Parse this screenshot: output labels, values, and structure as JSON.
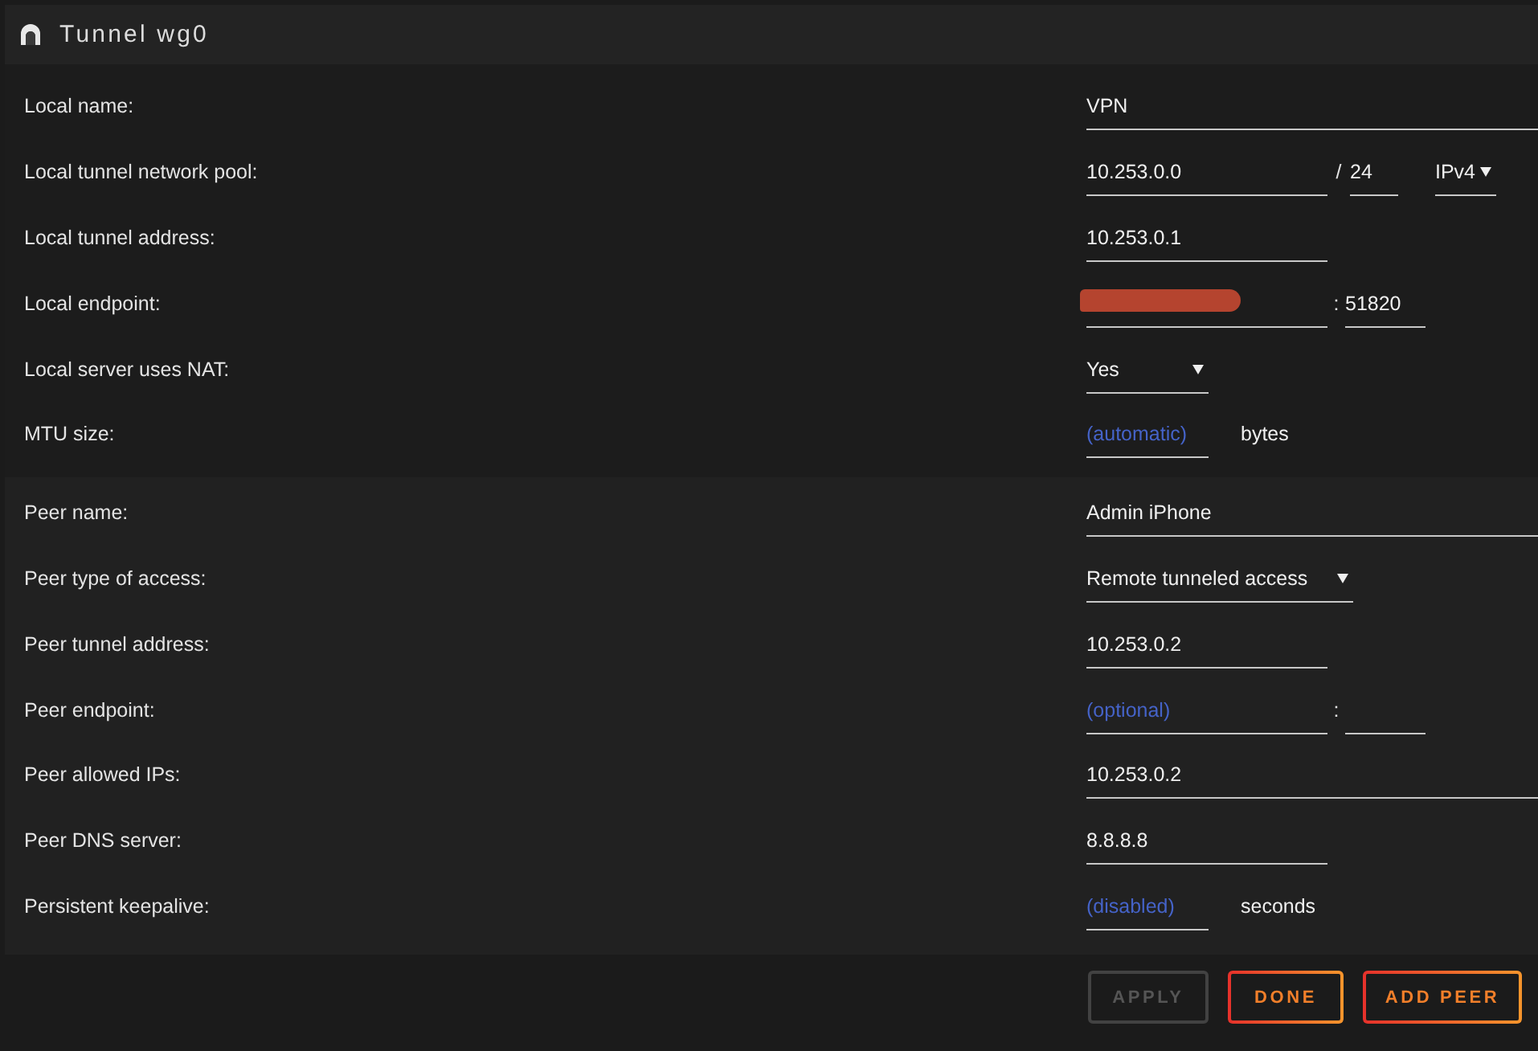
{
  "header": {
    "title": "Tunnel wg0"
  },
  "sections": [
    {
      "rows": [
        {
          "label": "Local name:",
          "controls": [
            {
              "kind": "input",
              "value": "VPN"
            }
          ]
        },
        {
          "label": "Local tunnel network pool:",
          "controls": [
            {
              "kind": "input",
              "value": "10.253.0.0"
            },
            {
              "kind": "text",
              "text": "/"
            },
            {
              "kind": "input",
              "value": "24"
            },
            {
              "kind": "select",
              "value": "IPv4"
            }
          ]
        },
        {
          "label": "Local tunnel address:",
          "controls": [
            {
              "kind": "input",
              "value": "10.253.0.1"
            }
          ]
        },
        {
          "label": "Local endpoint:",
          "controls": [
            {
              "kind": "input",
              "redacted": true
            },
            {
              "kind": "text",
              "text": ":"
            },
            {
              "kind": "input",
              "value": "51820"
            }
          ]
        },
        {
          "label": "Local server uses NAT:",
          "controls": [
            {
              "kind": "select",
              "value": "Yes"
            }
          ]
        },
        {
          "label": "MTU size:",
          "controls": [
            {
              "kind": "input",
              "placeholder": "(automatic)"
            },
            {
              "kind": "text",
              "text": "bytes"
            }
          ]
        }
      ]
    },
    {
      "rows": [
        {
          "label": "Peer name:",
          "controls": [
            {
              "kind": "input",
              "value": "Admin iPhone"
            }
          ]
        },
        {
          "label": "Peer type of access:",
          "controls": [
            {
              "kind": "select",
              "value": "Remote tunneled access"
            }
          ]
        },
        {
          "label": "Peer tunnel address:",
          "controls": [
            {
              "kind": "input",
              "value": "10.253.0.2"
            }
          ]
        },
        {
          "label": "Peer endpoint:",
          "controls": [
            {
              "kind": "input",
              "placeholder": "(optional)"
            },
            {
              "kind": "text",
              "text": ":"
            },
            {
              "kind": "input"
            }
          ]
        },
        {
          "label": "Peer allowed IPs:",
          "controls": [
            {
              "kind": "input",
              "value": "10.253.0.2"
            }
          ]
        },
        {
          "label": "Peer DNS server:",
          "controls": [
            {
              "kind": "input",
              "value": "8.8.8.8"
            }
          ]
        },
        {
          "label": "Persistent keepalive:",
          "controls": [
            {
              "kind": "input",
              "placeholder": "(disabled)"
            },
            {
              "kind": "text",
              "text": "seconds"
            }
          ]
        }
      ]
    }
  ],
  "buttons": [
    {
      "label": "APPLY",
      "disabled": true
    },
    {
      "label": "DONE",
      "disabled": false
    },
    {
      "label": "ADD PEER",
      "disabled": false
    }
  ]
}
